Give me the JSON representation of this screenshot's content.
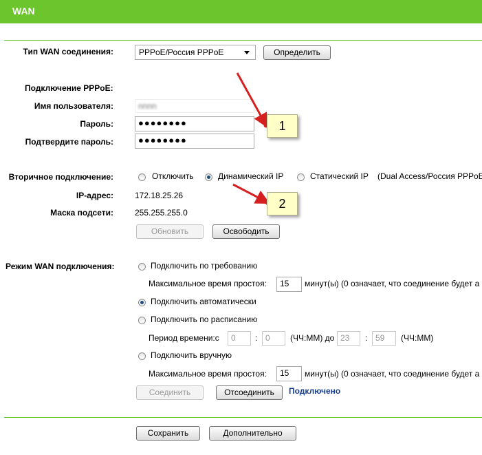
{
  "header": {
    "title": "WAN"
  },
  "wan_type": {
    "label": "Тип WAN соединения:",
    "value": "PPPoE/Россия PPPoE",
    "detect_button": "Определить"
  },
  "pppoe": {
    "section_label": "Подключение PPPoE:",
    "username_label": "Имя пользователя:",
    "username_value": "nnnn",
    "password_label": "Пароль:",
    "password_value": "●●●●●●●●",
    "confirm_label": "Подтвердите пароль:",
    "confirm_value": "●●●●●●●●"
  },
  "secondary": {
    "label": "Вторичное подключение:",
    "options": [
      "Отключить",
      "Динамический IP",
      "Статический IP"
    ],
    "selected": "Динамический IP",
    "note": "(Dual Access/Россия PPPoE",
    "ip_label": "IP-адрес:",
    "ip_value": "172.18.25.26",
    "mask_label": "Маска подсети:",
    "mask_value": "255.255.255.0",
    "refresh_button": "Обновить",
    "release_button": "Освободить"
  },
  "wan_mode": {
    "label": "Режим WAN подключения:",
    "on_demand": "Подключить по требованию",
    "idle_label": "Максимальное время простоя:",
    "idle_value": "15",
    "idle_suffix": "минут(ы) (0 означает, что соединение будет а",
    "auto": "Подключить автоматически",
    "schedule": "Подключить по расписанию",
    "period_label": "Период времени:с",
    "from_h": "0",
    "from_m": "0",
    "hhmm_to": "(ЧЧ:ММ) до",
    "to_h": "23",
    "to_m": "59",
    "hhmm": "(ЧЧ:ММ)",
    "colon": ":",
    "manual": "Подключить вручную",
    "idle2_label": "Максимальное время простоя:",
    "idle2_value": "15",
    "idle2_suffix": "минут(ы) (0 означает, что соединение будет а",
    "selected": "Подключить автоматически",
    "connect_button": "Соединить",
    "disconnect_button": "Отсоединить",
    "status": "Подключено"
  },
  "footer": {
    "save_button": "Сохранить",
    "advanced_button": "Дополнительно"
  },
  "annotations": [
    {
      "number": "1"
    },
    {
      "number": "2"
    }
  ],
  "colors": {
    "header": "#6cc52c",
    "arrow": "#d62020",
    "callout_bg": "#ffffc8",
    "status_text": "#1a3f8f"
  }
}
